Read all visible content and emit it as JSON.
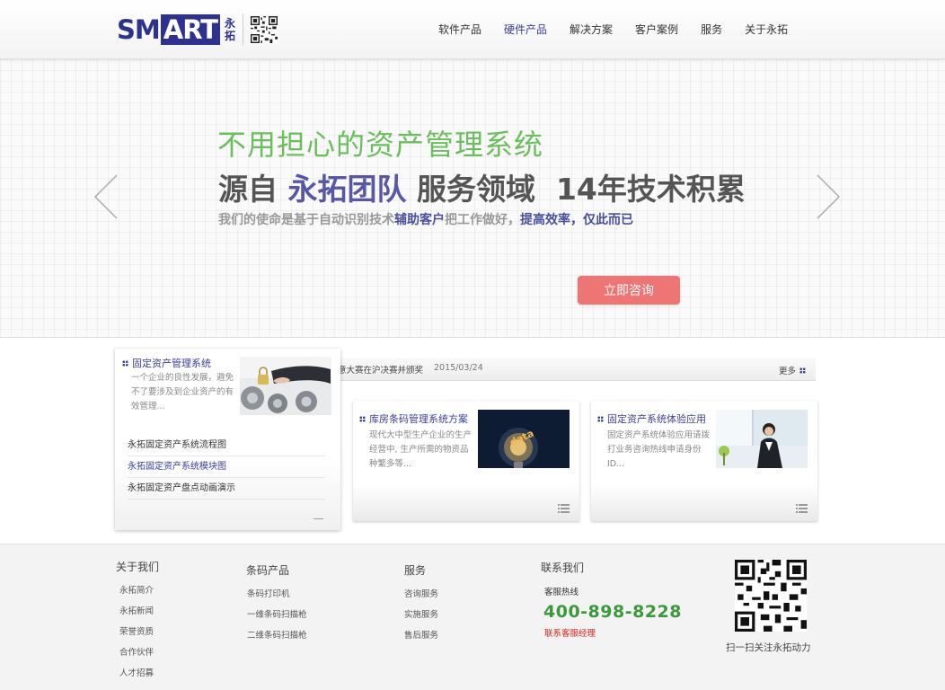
{
  "header": {
    "logo_text_a": "SM",
    "logo_text_b": "ART",
    "logo_cn_1": "永",
    "logo_cn_2": "拓",
    "nav": [
      {
        "label": "软件产品",
        "active": false
      },
      {
        "label": "硬件产品",
        "active": true
      },
      {
        "label": "解决方案",
        "active": false
      },
      {
        "label": "客户案例",
        "active": false
      },
      {
        "label": "服务",
        "active": false
      },
      {
        "label": "关于永拓",
        "active": false
      }
    ],
    "accent_color": "#3b3f9a"
  },
  "banner": {
    "headline1": "不用担心的资产管理系统",
    "headline2_a": "源自 ",
    "headline2_b": "永拓团队",
    "headline2_c": " 服务领域  14年技术积累",
    "sub_a": "我们的使命是基于自动识别技术",
    "sub_b": "辅助客户",
    "sub_c": "把工作做好，",
    "sub_d": "提高效率，仅此而已",
    "button": "立即咨询",
    "button_color": "#ef7474",
    "headline1_color": "#6abf5c"
  },
  "left_card": {
    "title": "固定资产管理系统",
    "desc": "一个企业的良性发展，避免不了要涉及到企业资产的有效管理...",
    "links": [
      {
        "label": "永拓固定资产系统流程图",
        "active": false
      },
      {
        "label": "永拓固定资产系统模块图",
        "active": true
      },
      {
        "label": "永拓固定资产盘点动画演示",
        "active": false
      }
    ]
  },
  "news": {
    "text": "意大赛在沪决赛并颁奖",
    "date": "2015/03/24",
    "more": "更多"
  },
  "products": [
    {
      "title": "库房条码管理系统方案",
      "desc": "现代大中型生产企业的生产经营中, 生产所需的物资品种繁多等..."
    },
    {
      "title": "固定资产系统体验应用",
      "desc": "固定资产系统体验应用请拨打业务咨询热线申请身份ID..."
    }
  ],
  "footer": {
    "about": {
      "title": "关于我们",
      "items": [
        "永拓简介",
        "永拓新闻",
        "荣誉资质",
        "合作伙伴",
        "人才招募"
      ]
    },
    "barcode": {
      "title": "条码产品",
      "items": [
        "条码打印机",
        "一维条码扫描枪",
        "二维条码扫描枪"
      ]
    },
    "service": {
      "title": "服务",
      "items": [
        "咨询服务",
        "实施服务",
        "售后服务"
      ]
    },
    "contact": {
      "title": "联系我们",
      "hotline_label": "客服热线",
      "hotline": "400-898-8228",
      "manager": "联系客服经理"
    },
    "qr_caption": "扫一扫关注永拓动力"
  }
}
